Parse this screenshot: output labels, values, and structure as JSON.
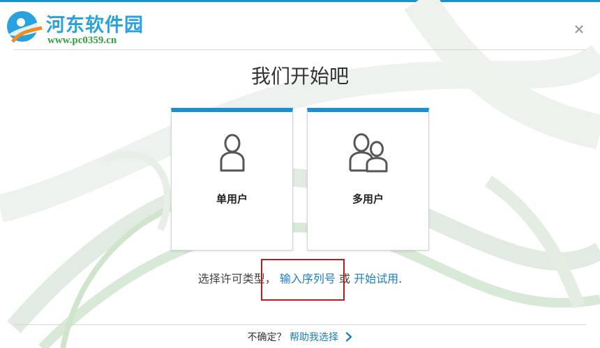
{
  "watermark": {
    "title": "河东软件园",
    "url": "www.pc0359.cn"
  },
  "dialog": {
    "title": "我们开始吧",
    "close_glyph": "×"
  },
  "license_options": [
    {
      "label": "单用户",
      "icon": "single-user-icon"
    },
    {
      "label": "多用户",
      "icon": "multi-user-icon"
    }
  ],
  "license_type": {
    "prefix": "选择许可类型，",
    "serial_link": "输入序列号",
    "or_text": "或",
    "trial_link": "开始试用",
    "suffix": "."
  },
  "help": {
    "prefix": "不确定？",
    "link": "帮助我选择",
    "icon": "chevron-right-icon"
  },
  "colors": {
    "accent": "#1a8fd6",
    "link": "#1a7fc4",
    "highlight": "#c0161c"
  }
}
